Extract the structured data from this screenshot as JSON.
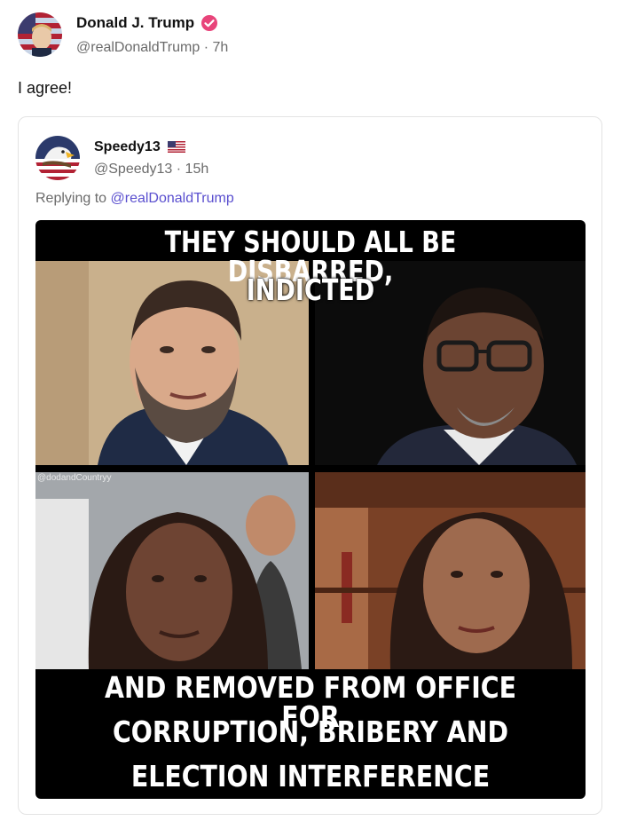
{
  "post": {
    "author_name": "Donald J. Trump",
    "handle": "@realDonaldTrump",
    "time": "7h",
    "text": "I agree!",
    "verified_icon": "verified-check-icon"
  },
  "quote": {
    "author_name": "Speedy13",
    "flag": "🇺🇸",
    "handle": "@Speedy13",
    "time": "15h",
    "replying_prefix": "Replying to",
    "replying_to": "@realDonaldTrump"
  },
  "meme": {
    "top_line_1": "THEY SHOULD ALL BE DISBARRED,",
    "top_line_2": "INDICTED",
    "bottom_line_1": "AND REMOVED FROM OFFICE FOR",
    "bottom_line_2": "CORRUPTION, BRIBERY AND",
    "bottom_line_3": "ELECTION INTERFERENCE",
    "watermark": "@dodandCountryy"
  },
  "colors": {
    "verified": "#e8447a",
    "mention": "#5a4fcf",
    "muted": "#6b6b6b"
  }
}
